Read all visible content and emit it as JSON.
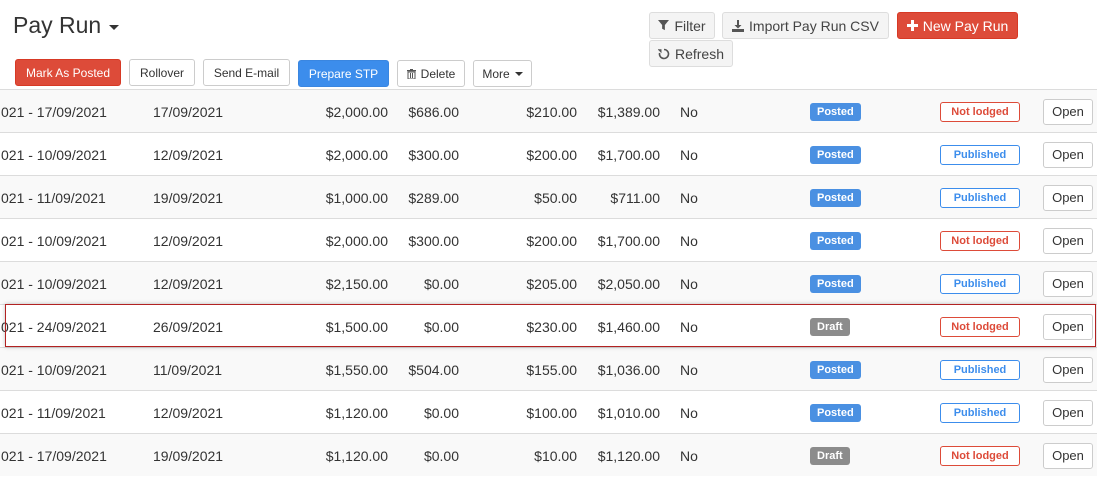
{
  "header": {
    "title": "Pay Run"
  },
  "toolbar": {
    "mark_as_posted": "Mark As Posted",
    "rollover": "Rollover",
    "send_email": "Send E-mail",
    "prepare_stp": "Prepare STP",
    "delete": "Delete",
    "more": "More"
  },
  "top_actions": {
    "filter": "Filter",
    "import_csv": "Import Pay Run CSV",
    "new_pay_run": "New Pay Run",
    "refresh": "Refresh"
  },
  "rows": [
    {
      "period": "021 - 17/09/2021",
      "date": "17/09/2021",
      "gross": "$2,000.00",
      "tax": "$686.00",
      "super": "$210.00",
      "net": "$1,389.00",
      "flag": "No",
      "status": "Posted",
      "stp": "Not lodged",
      "open": "Open"
    },
    {
      "period": "021 - 10/09/2021",
      "date": "12/09/2021",
      "gross": "$2,000.00",
      "tax": "$300.00",
      "super": "$200.00",
      "net": "$1,700.00",
      "flag": "No",
      "status": "Posted",
      "stp": "Published",
      "open": "Open"
    },
    {
      "period": "021 - 11/09/2021",
      "date": "19/09/2021",
      "gross": "$1,000.00",
      "tax": "$289.00",
      "super": "$50.00",
      "net": "$711.00",
      "flag": "No",
      "status": "Posted",
      "stp": "Published",
      "open": "Open"
    },
    {
      "period": "021 - 10/09/2021",
      "date": "12/09/2021",
      "gross": "$2,000.00",
      "tax": "$300.00",
      "super": "$200.00",
      "net": "$1,700.00",
      "flag": "No",
      "status": "Posted",
      "stp": "Not lodged",
      "open": "Open"
    },
    {
      "period": "021 - 10/09/2021",
      "date": "12/09/2021",
      "gross": "$2,150.00",
      "tax": "$0.00",
      "super": "$205.00",
      "net": "$2,050.00",
      "flag": "No",
      "status": "Posted",
      "stp": "Published",
      "open": "Open"
    },
    {
      "period": "021 - 24/09/2021",
      "date": "26/09/2021",
      "gross": "$1,500.00",
      "tax": "$0.00",
      "super": "$230.00",
      "net": "$1,460.00",
      "flag": "No",
      "status": "Draft",
      "stp": "Not lodged",
      "open": "Open"
    },
    {
      "period": "021 - 10/09/2021",
      "date": "11/09/2021",
      "gross": "$1,550.00",
      "tax": "$504.00",
      "super": "$155.00",
      "net": "$1,036.00",
      "flag": "No",
      "status": "Posted",
      "stp": "Published",
      "open": "Open"
    },
    {
      "period": "021 - 11/09/2021",
      "date": "12/09/2021",
      "gross": "$1,120.00",
      "tax": "$0.00",
      "super": "$100.00",
      "net": "$1,010.00",
      "flag": "No",
      "status": "Posted",
      "stp": "Published",
      "open": "Open"
    },
    {
      "period": "021 - 17/09/2021",
      "date": "19/09/2021",
      "gross": "$1,120.00",
      "tax": "$0.00",
      "super": "$10.00",
      "net": "$1,120.00",
      "flag": "No",
      "status": "Draft",
      "stp": "Not lodged",
      "open": "Open"
    }
  ],
  "colors": {
    "red": "#dd4b39",
    "blue": "#3c8dec",
    "posted_badge": "#4a90e2",
    "draft_badge": "#8c8c8c",
    "highlight_border": "#b22222"
  }
}
